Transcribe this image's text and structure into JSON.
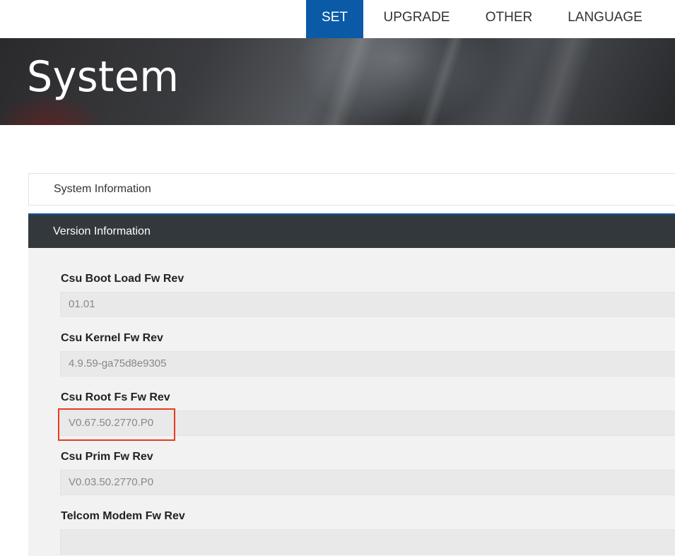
{
  "nav": {
    "items": [
      {
        "label": "SET",
        "active": true
      },
      {
        "label": "UPGRADE",
        "active": false
      },
      {
        "label": "OTHER",
        "active": false
      },
      {
        "label": "LANGUAGE",
        "active": false
      }
    ]
  },
  "banner": {
    "title": "System"
  },
  "sections": {
    "system_information": "System Information",
    "version_information": "Version Information"
  },
  "fields": [
    {
      "label": "Csu Boot Load Fw Rev",
      "value": "01.01"
    },
    {
      "label": "Csu Kernel Fw Rev",
      "value": "4.9.59-ga75d8e9305"
    },
    {
      "label": "Csu Root Fs Fw Rev",
      "value": "V0.67.50.2770.P0"
    },
    {
      "label": "Csu Prim Fw Rev",
      "value": "V0.03.50.2770.P0"
    },
    {
      "label": "Telcom Modem Fw Rev",
      "value": ""
    }
  ],
  "colors": {
    "accent": "#0a5aa8",
    "dark_header": "#33383d",
    "highlight_border": "#e63a1e"
  }
}
